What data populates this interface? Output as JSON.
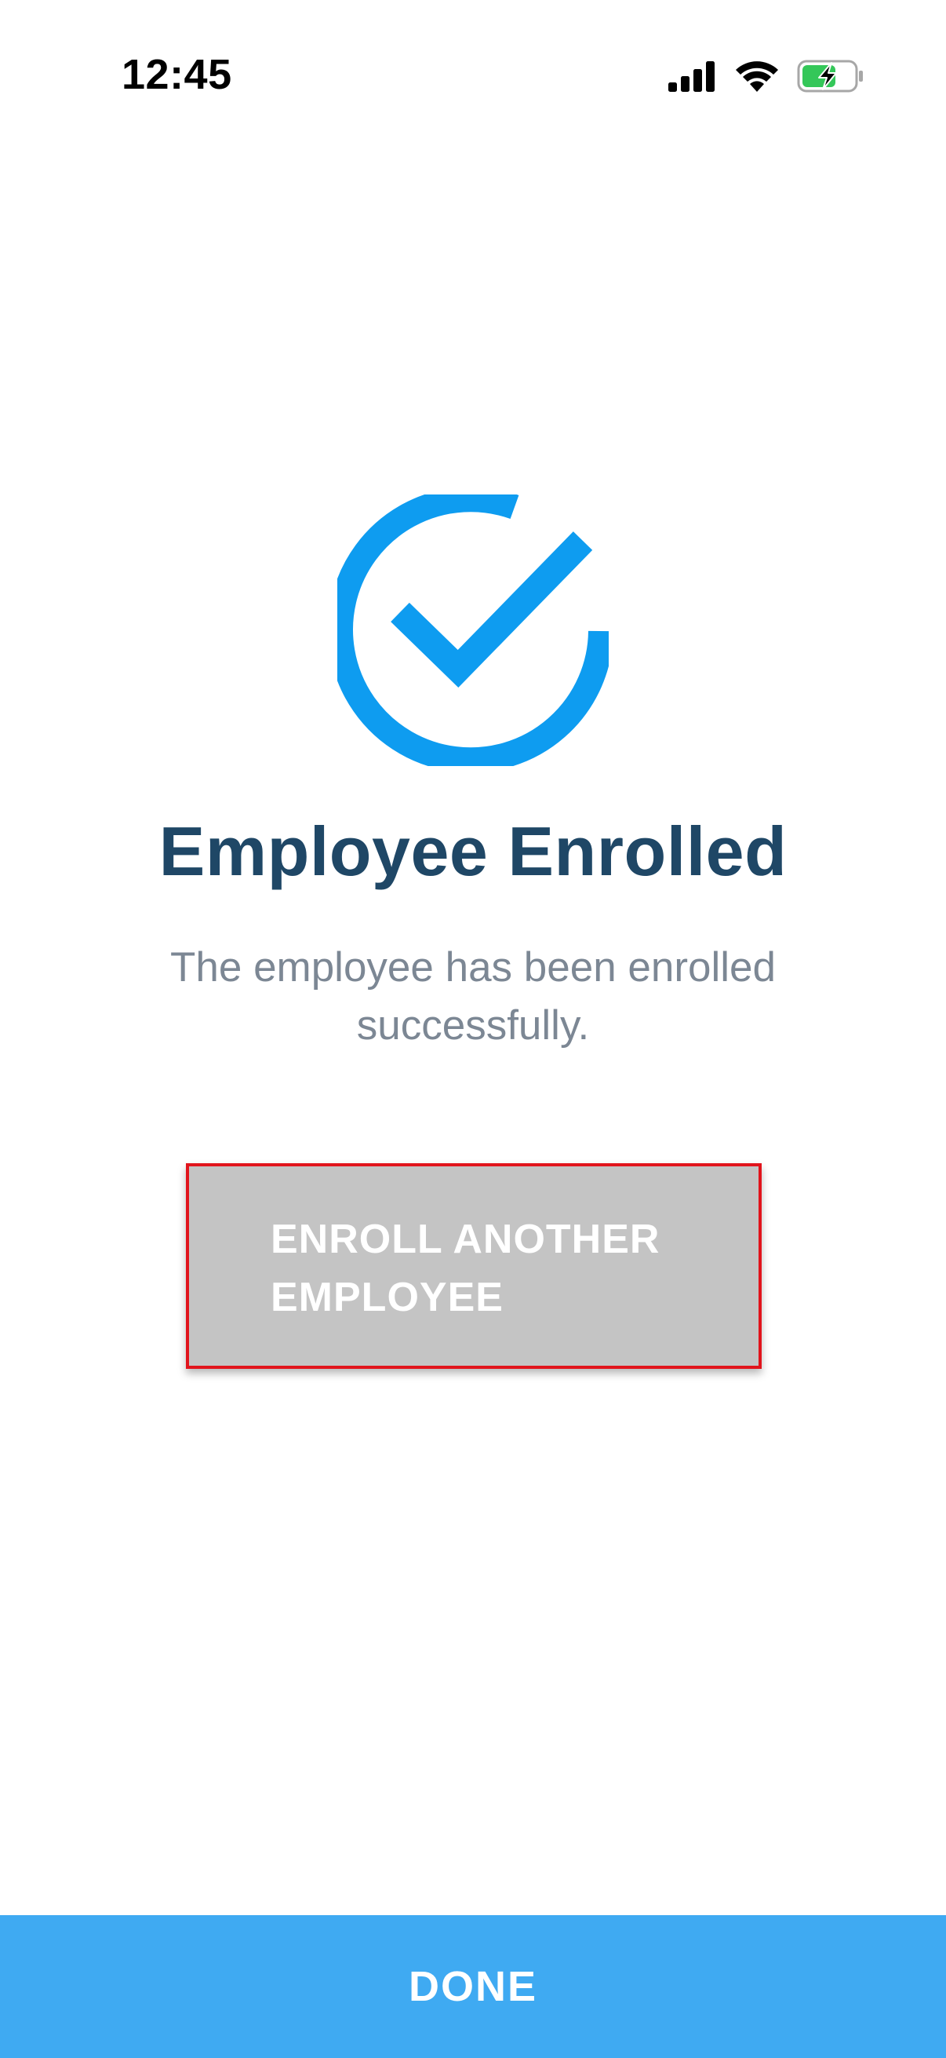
{
  "status_bar": {
    "time": "12:45",
    "icons": [
      "signal-icon",
      "wifi-icon",
      "battery-charging-icon"
    ]
  },
  "success": {
    "icon": "check-circle-icon",
    "icon_color": "#0e9cf0",
    "title": "Employee Enrolled",
    "message": "The employee has been enrolled successfully."
  },
  "actions": {
    "enroll_another_label": "ENROLL ANOTHER\nEMPLOYEE",
    "done_label": "DONE"
  },
  "colors": {
    "title": "#1f4766",
    "message": "#7c8794",
    "enroll_button_bg": "#c4c4c4",
    "highlight_border": "#e1141c",
    "done_bar": "#3faaf2"
  }
}
